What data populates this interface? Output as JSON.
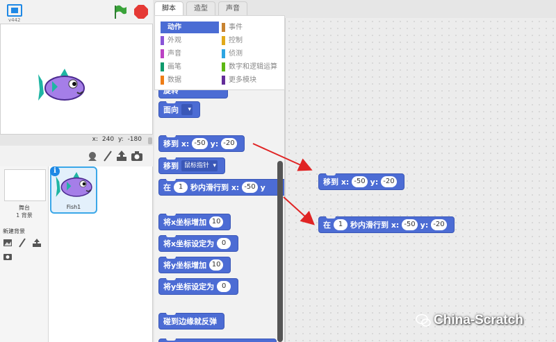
{
  "stage": {
    "version": "v442",
    "coords": {
      "x_label": "x:",
      "x_value": "240",
      "y_label": "y:",
      "y_value": "-180"
    }
  },
  "sprites": {
    "backdrop_name": "舞台",
    "backdrop_count": "1 背景",
    "new_backdrop_label": "新建背景",
    "sprite_name": "Fish1",
    "info_glyph": "i"
  },
  "tabs": [
    "脚本",
    "造型",
    "声音"
  ],
  "categories": [
    {
      "label": "动作",
      "color": "#4a6cd4",
      "active": true
    },
    {
      "label": "事件",
      "color": "#c88330"
    },
    {
      "label": "外观",
      "color": "#8a55d7"
    },
    {
      "label": "控制",
      "color": "#e1a91a"
    },
    {
      "label": "声音",
      "color": "#bb42c3"
    },
    {
      "label": "侦测",
      "color": "#2ca5e2"
    },
    {
      "label": "画笔",
      "color": "#0e9a6c"
    },
    {
      "label": "数字和逻辑运算",
      "color": "#5cb712"
    },
    {
      "label": "数据",
      "color": "#ee7d16"
    },
    {
      "label": "更多模块",
      "color": "#632d99"
    }
  ],
  "palette_blocks": {
    "partial_top": "旋转",
    "point_direction": "面向",
    "goto_xy": {
      "label": "移到 x:",
      "x": "-50",
      "y_label": "y:",
      "y": "-20"
    },
    "goto_target": {
      "label": "移到",
      "option": "鼠标指针"
    },
    "glide": {
      "label": "在",
      "secs": "1",
      "mid": "秒内滑行到 x:",
      "x": "-50",
      "y_label": "y"
    },
    "change_x": {
      "label": "将x坐标增加",
      "value": "10"
    },
    "set_x": {
      "label": "将x坐标设定为",
      "value": "0"
    },
    "change_y": {
      "label": "将y坐标增加",
      "value": "10"
    },
    "set_y": {
      "label": "将y坐标设定为",
      "value": "0"
    },
    "bounce": "碰到边缘就反弹"
  },
  "script_blocks": {
    "goto_xy": {
      "label": "移到 x:",
      "x": "-50",
      "y_label": "y:",
      "y": "-20"
    },
    "glide": {
      "label": "在",
      "secs": "1",
      "mid": "秒内滑行到 x:",
      "x": "-50",
      "y_label": "y:",
      "y": "-20"
    }
  },
  "watermark": "China-Scratch",
  "colors": {
    "motion": "#4c6cd4",
    "arrow": "#e02424",
    "accent": "#1e88e5",
    "stop": "#e53935",
    "flag": "#2e7d32"
  }
}
